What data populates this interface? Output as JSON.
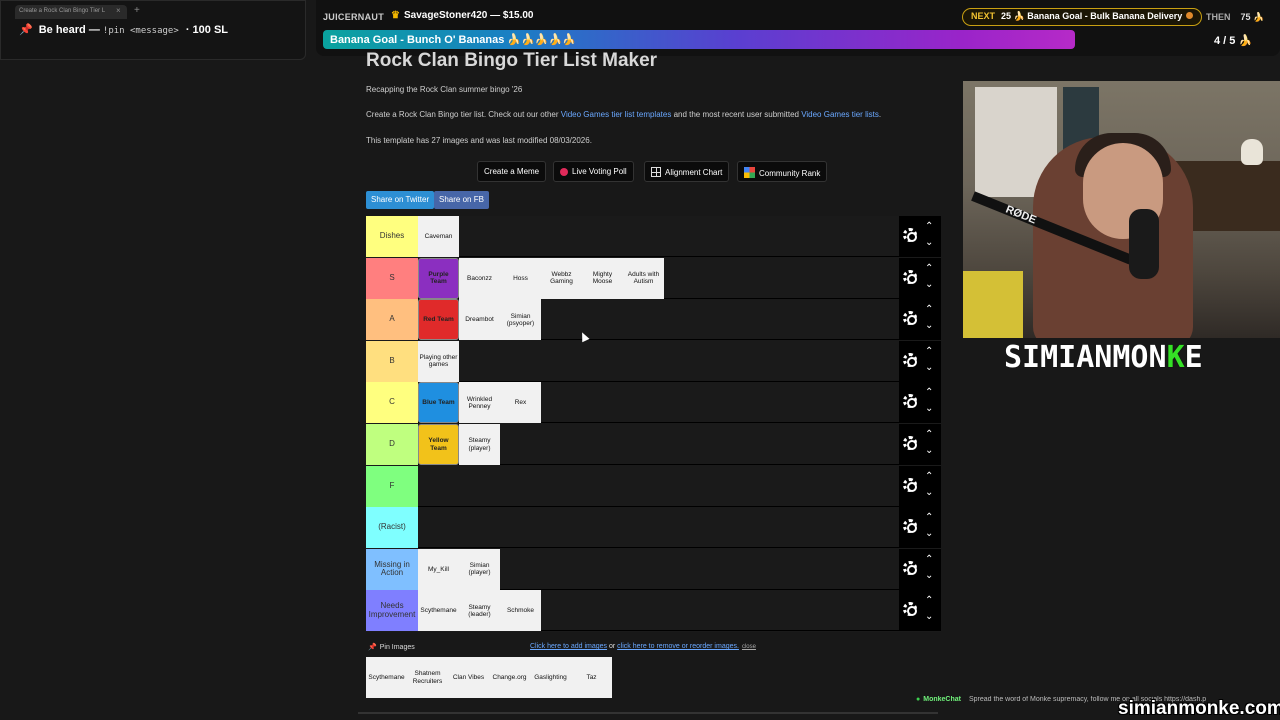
{
  "browser": {
    "tab_title": "Create a Rock Clan Bingo Tier L",
    "tab_close": "×",
    "tab_add": "+"
  },
  "be_heard": {
    "title": "Be heard —",
    "command": "!pin <message>",
    "cost": "· 100 SL"
  },
  "overlay": {
    "donor_label": "JUICERNAUT",
    "donor": "SavageStoner420 — $15.00",
    "goal_text": "Banana Goal - Bunch O' Bananas 🍌🍌🍌🍌🍌",
    "next_label": "NEXT",
    "next_goal": "25 🍌 Banana Goal - Bulk Banana Delivery",
    "then_label": "THEN",
    "then_value": "75 🍌",
    "progress": "4 / 5 🍌"
  },
  "page": {
    "title": "Rock Clan Bingo Tier List Maker",
    "subtitle": "Recapping the Rock Clan summer bingo '26",
    "desc_prefix": "Create a Rock Clan Bingo tier list. Check out our other ",
    "desc_link1": "Video Games tier list templates",
    "desc_middle": " and the most recent user submitted ",
    "desc_link2": "Video Games tier lists",
    "desc_suffix": ".",
    "meta": "This template has 27 images and was last modified 08/03/2026."
  },
  "toolbar": {
    "meme": "Create a Meme",
    "poll": "Live Voting Poll",
    "align": "Alignment Chart",
    "community": "Community Rank"
  },
  "share": {
    "twitter": "Share on Twitter",
    "facebook": "Share on FB"
  },
  "tiers": [
    {
      "label": "Dishes",
      "color": "#ffff7f",
      "items": [
        {
          "name": "Caveman"
        }
      ]
    },
    {
      "label": "S",
      "color": "#ff7f7f",
      "items": [
        {
          "name": "Purple Team",
          "img": "#8b2fc0"
        },
        {
          "name": "Baconzz"
        },
        {
          "name": "Hoss"
        },
        {
          "name": "Webbz Gaming"
        },
        {
          "name": "Mighty Moose"
        },
        {
          "name": "Adults with Autism"
        }
      ]
    },
    {
      "label": "A",
      "color": "#ffbf7f",
      "items": [
        {
          "name": "Red Team",
          "img": "#e02a2a"
        },
        {
          "name": "Dreambot"
        },
        {
          "name": "Simian (psyoper)"
        }
      ]
    },
    {
      "label": "B",
      "color": "#ffdf7f",
      "items": [
        {
          "name": "Playing other games"
        }
      ]
    },
    {
      "label": "C",
      "color": "#ffff7f",
      "items": [
        {
          "name": "Blue Team",
          "img": "#1f8fe0"
        },
        {
          "name": "Wrinkled Penney"
        },
        {
          "name": "Rex"
        }
      ]
    },
    {
      "label": "D",
      "color": "#bfff7f",
      "items": [
        {
          "name": "Yellow Team",
          "img": "#f2c21a"
        },
        {
          "name": "Steamy (player)"
        }
      ]
    },
    {
      "label": "F",
      "color": "#7fff7f",
      "items": []
    },
    {
      "label": "(Racist)",
      "color": "#7fffff",
      "items": []
    },
    {
      "label": "Missing in Action",
      "color": "#7fbfff",
      "items": [
        {
          "name": "My_Kill"
        },
        {
          "name": "Simian (player)"
        }
      ]
    },
    {
      "label": "Needs Improvement",
      "color": "#7f7fff",
      "items": [
        {
          "name": "Scythemane"
        },
        {
          "name": "Steamy (leader)"
        },
        {
          "name": "Schmoke"
        }
      ]
    }
  ],
  "pin_images": "Pin Images",
  "add_images": {
    "link1": "Click here to add images",
    "middle": " or ",
    "link2": "click here to remove or reorder images.",
    "close": "close"
  },
  "pool": [
    "Scythemane",
    "Shatnem Recruiters",
    "Clan Vibes",
    "Change.org",
    "Gaslighting",
    "Taz"
  ],
  "webcam": {
    "mic_brand": "RØDE"
  },
  "brand": {
    "before": "SIMIANMON",
    "highlight": "K",
    "after": "E"
  },
  "bottom": {
    "chat_label": "MonkeChat",
    "chat_message": "Spread the word of Monke supremacy, follow me on all socials https://dash.p",
    "site": "simianmonke.com"
  },
  "colors": {
    "link": "#6aa8ff",
    "brand_highlight": "#35e026",
    "goal_gradient_start": "#0aa39e",
    "goal_gradient_end": "#b62ac8"
  }
}
